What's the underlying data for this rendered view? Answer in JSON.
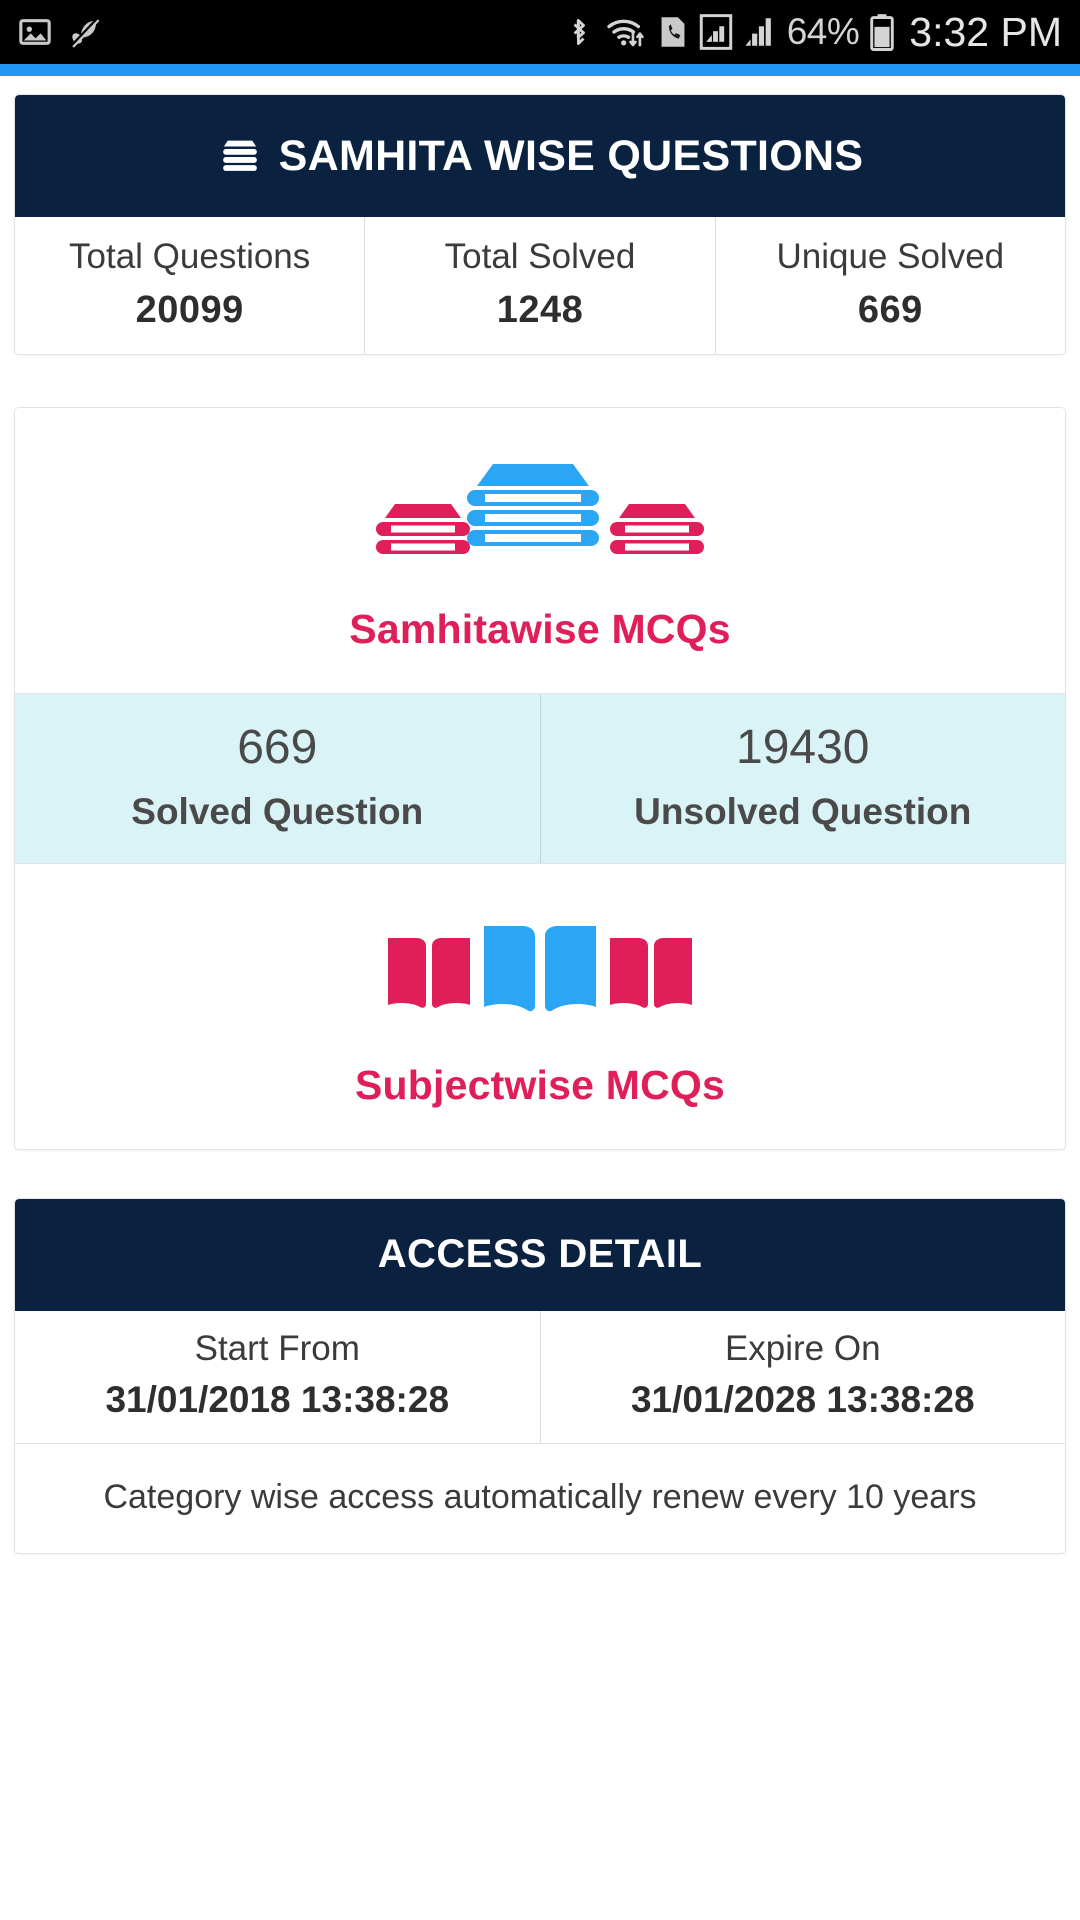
{
  "status_bar": {
    "battery_percent": "64%",
    "time": "3:32 PM",
    "icons": [
      "image-icon",
      "leaf-muted-icon",
      "bluetooth-icon",
      "wifi-icon",
      "sim-call-icon",
      "signal-boxed-icon",
      "signal-bars-icon",
      "battery-icon"
    ]
  },
  "header": {
    "title": "SAMHITA WISE QUESTIONS",
    "icon": "books-stack-icon"
  },
  "stats": [
    {
      "label": "Total Questions",
      "value": "20099"
    },
    {
      "label": "Total Solved",
      "value": "1248"
    },
    {
      "label": "Unique Solved",
      "value": "669"
    }
  ],
  "samhitawise": {
    "caption": "Samhitawise MCQs",
    "icon": "stacked-books-icon",
    "solved": {
      "value": "669",
      "label": "Solved Question"
    },
    "unsolved": {
      "value": "19430",
      "label": "Unsolved Question"
    }
  },
  "subjectwise": {
    "caption": "Subjectwise MCQs",
    "icon": "open-books-icon"
  },
  "access_detail": {
    "title": "ACCESS DETAIL",
    "start": {
      "label": "Start From",
      "value": "31/01/2018 13:38:28"
    },
    "expire": {
      "label": "Expire On",
      "value": "31/01/2028 13:38:28"
    },
    "note": "Category wise access automatically renew every 10 years"
  },
  "colors": {
    "navy": "#0a2240",
    "accent_blue": "#2196f3",
    "crimson": "#e01f5a",
    "cyan_band": "#d9f3f6"
  }
}
